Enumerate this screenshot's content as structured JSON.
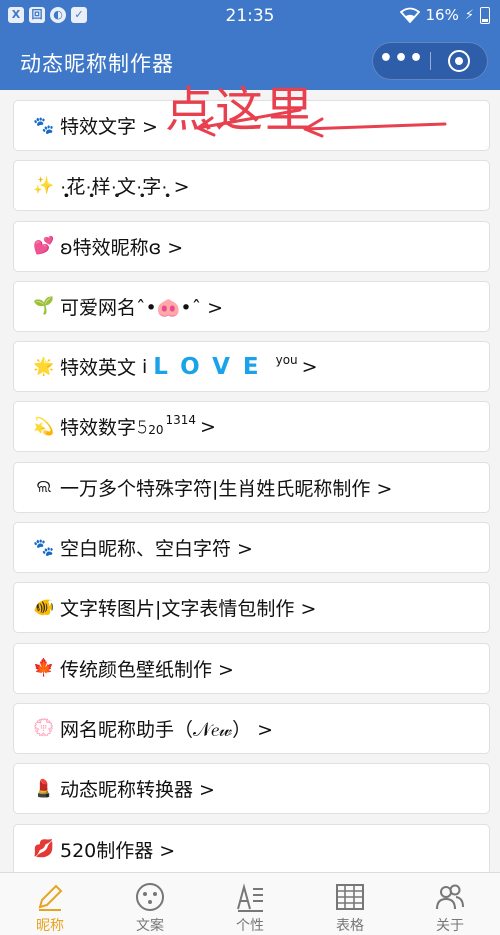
{
  "status_bar": {
    "left_icons": [
      "X",
      "回",
      "◐",
      "✓"
    ],
    "time": "21:35",
    "battery": "16%"
  },
  "nav": {
    "title": "动态昵称制作器",
    "more_icon": "more-dots-icon",
    "close_icon": "target-close-icon"
  },
  "annotation": {
    "text": "点这里",
    "color": "#e8404f"
  },
  "items": [
    {
      "emoji": "🐾",
      "label": "特效文字 >"
    },
    {
      "emoji": "✨",
      "label": "·͙̩͙̩̥͙̥花·͙̩̥样·͙̩̥文·͙̩̥字·͙̩̥ >"
    },
    {
      "emoji": "💕",
      "label": "ʚ特效昵称ɞ >"
    },
    {
      "emoji": "🌱",
      "label": "可爱网名ˆ•🐽•ˆ >"
    },
    {
      "emoji": "🌟",
      "label": "特效英文",
      "extra_prefix": "ⅰ",
      "love": "LOVE",
      "sup": "you",
      "tail": ">"
    },
    {
      "emoji": "💫",
      "label": "特效数字",
      "extra_prefix": "𝟻",
      "sub": "20",
      "sup": "1314",
      "tail": ">"
    },
    {
      "emoji": "ଲ",
      "label": "一万多个特殊字符|生肖姓氏昵称制作 >"
    },
    {
      "emoji": "🐾",
      "label": "空白昵称、空白字符 >"
    },
    {
      "emoji": "🐠",
      "label": "文字转图片|文字表情包制作 >"
    },
    {
      "emoji": "🍁",
      "label": "传统颜色壁纸制作 >"
    },
    {
      "emoji": "💮",
      "label": "网名昵称助手（𝒩𝑒𝓌） >"
    },
    {
      "emoji": "💄",
      "label": "动态昵称转换器 >"
    },
    {
      "emoji": "💋",
      "label": "520制作器 >"
    }
  ],
  "tabs": [
    {
      "label": "昵称",
      "icon": "pencil-icon",
      "active": true
    },
    {
      "label": "文案",
      "icon": "face-dots-icon",
      "active": false
    },
    {
      "label": "个性",
      "icon": "text-lines-icon",
      "active": false
    },
    {
      "label": "表格",
      "icon": "grid-table-icon",
      "active": false
    },
    {
      "label": "关于",
      "icon": "people-icon",
      "active": false
    }
  ],
  "colors": {
    "brand_blue": "#3f78c9",
    "active_tab": "#e8a320",
    "love_blue": "#1aa3e8"
  }
}
